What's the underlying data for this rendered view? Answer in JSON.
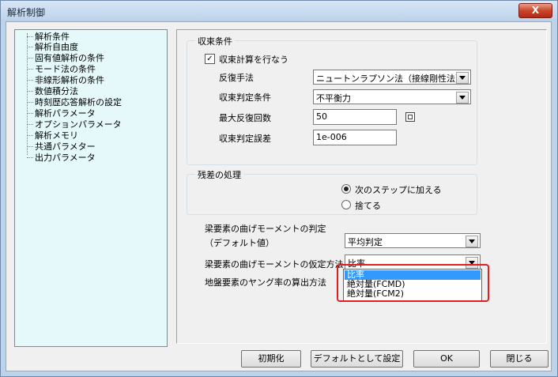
{
  "window": {
    "title": "解析制御",
    "close_label": "X"
  },
  "tree": {
    "items": [
      "解析条件",
      "解析自由度",
      "固有値解析の条件",
      "モード法の条件",
      "非線形解析の条件",
      "数値積分法",
      "時刻歴応答解析の設定",
      "解析パラメータ",
      "オプションパラメータ",
      "解析メモリ",
      "共通パラメター",
      "出力パラメータ"
    ]
  },
  "convergence": {
    "group_title": "収束条件",
    "checkbox_label": "収束計算を行なう",
    "checked": true,
    "method_label": "反復手法",
    "method_value": "ニュートンラプソン法（接線剛性法）",
    "criterion_label": "収束判定条件",
    "criterion_value": "不平衡力",
    "max_iter_label": "最大反復回数",
    "max_iter_value": "50",
    "tolerance_label": "収束判定誤差",
    "tolerance_value": "1e-006"
  },
  "residual": {
    "group_title": "残差の処理",
    "options": [
      "次のステップに加える",
      "捨てる"
    ],
    "selected_index": 0
  },
  "beam": {
    "moment_label_line1": "梁要素の曲げモーメントの判定",
    "moment_label_line2": "（デフォルト値）",
    "moment_value": "平均判定",
    "assume_label": "梁要素の曲げモーメントの仮定方法",
    "assume_value": "比率",
    "ground_label": "地盤要素のヤング率の算出方法"
  },
  "dropdown": {
    "options": [
      "比率",
      "絶対量(FCMD)",
      "絶対量(FCM2)"
    ],
    "selected_index": 0
  },
  "buttons": {
    "init": "初期化",
    "set_default": "デフォルトとして設定",
    "ok": "OK",
    "close": "閉じる"
  },
  "colors": {
    "tree_bg": "#e6f9fa",
    "highlight_border": "#e02020",
    "selection": "#3399ff"
  }
}
